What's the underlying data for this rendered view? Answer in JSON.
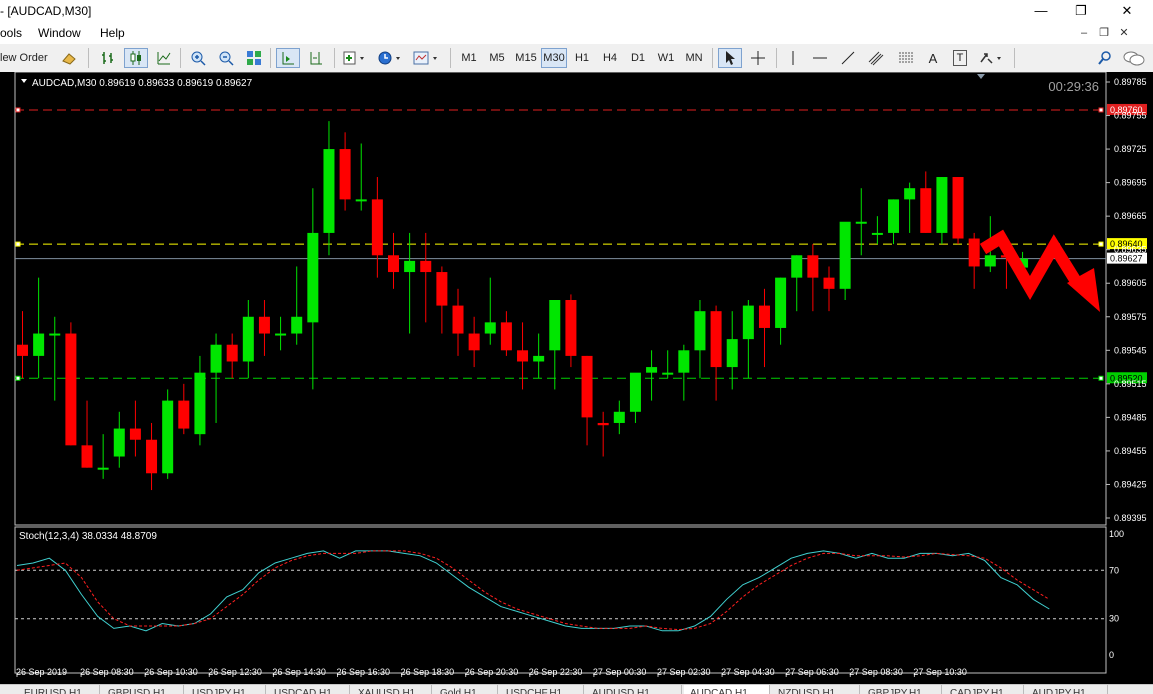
{
  "window": {
    "title": "- [AUDCAD,M30]",
    "minimize_glyph": "—",
    "restore_glyph": "❐",
    "close_glyph": "✕"
  },
  "menu": {
    "items": [
      "ools",
      "Window",
      "Help"
    ],
    "mdi_minimize": "–",
    "mdi_restore": "❐",
    "mdi_close": "✕"
  },
  "toolbar": {
    "new_order_label": "lew Order",
    "timeframes": [
      "M1",
      "M5",
      "M15",
      "M30",
      "H1",
      "H4",
      "D1",
      "W1",
      "MN"
    ],
    "selected_timeframe": "M30",
    "text_tool": "A",
    "label_tool": "T"
  },
  "chart": {
    "header": "AUDCAD,M30  0.89619 0.89633 0.89619 0.89627",
    "timer": "00:29:36",
    "bull_color": "#00e600",
    "bear_color": "#ff0000",
    "price_scale": [
      "0.89785",
      "0.89755",
      "0.89725",
      "0.89695",
      "0.89665",
      "0.89635",
      "0.89605",
      "0.89575",
      "0.89545",
      "0.89515",
      "0.89485",
      "0.89455",
      "0.89425",
      "0.89395"
    ],
    "lines": [
      {
        "name": "resistance",
        "price": 0.8976,
        "label": "0.89760",
        "color": "#e02020"
      },
      {
        "name": "pivot",
        "price": 0.8964,
        "label": "0.89640",
        "color": "#ffff00"
      },
      {
        "name": "support",
        "price": 0.8952,
        "label": "0.89520",
        "color": "#00d000"
      },
      {
        "name": "bid",
        "price": 0.89627,
        "label": "0.89627",
        "color": "#8090a0"
      }
    ],
    "candles": [
      [
        0.8955,
        0.8958,
        0.8952,
        0.8954
      ],
      [
        0.8954,
        0.8961,
        0.8952,
        0.8956
      ],
      [
        0.8956,
        0.89575,
        0.895,
        0.8956
      ],
      [
        0.8956,
        0.8957,
        0.8946,
        0.8946
      ],
      [
        0.8946,
        0.895,
        0.8944,
        0.8944
      ],
      [
        0.8944,
        0.8947,
        0.8943,
        0.8944
      ],
      [
        0.8945,
        0.8949,
        0.8944,
        0.89475
      ],
      [
        0.89475,
        0.895,
        0.8945,
        0.89465
      ],
      [
        0.89465,
        0.8948,
        0.8942,
        0.89435
      ],
      [
        0.89435,
        0.8951,
        0.8943,
        0.895
      ],
      [
        0.895,
        0.89515,
        0.8947,
        0.89475
      ],
      [
        0.8947,
        0.8954,
        0.8946,
        0.89525
      ],
      [
        0.89525,
        0.8956,
        0.8948,
        0.8955
      ],
      [
        0.8955,
        0.8956,
        0.8952,
        0.89535
      ],
      [
        0.89535,
        0.8959,
        0.8952,
        0.89575
      ],
      [
        0.89575,
        0.8959,
        0.8954,
        0.8956
      ],
      [
        0.8956,
        0.89575,
        0.89545,
        0.8956
      ],
      [
        0.8956,
        0.8962,
        0.8955,
        0.89575
      ],
      [
        0.8957,
        0.8969,
        0.8951,
        0.8965
      ],
      [
        0.8965,
        0.8975,
        0.8963,
        0.89725
      ],
      [
        0.89725,
        0.8974,
        0.8967,
        0.8968
      ],
      [
        0.8968,
        0.8973,
        0.8967,
        0.8968
      ],
      [
        0.8968,
        0.897,
        0.8961,
        0.8963
      ],
      [
        0.8963,
        0.8965,
        0.896,
        0.89615
      ],
      [
        0.89615,
        0.8965,
        0.8956,
        0.89625
      ],
      [
        0.89625,
        0.8965,
        0.8957,
        0.89615
      ],
      [
        0.89615,
        0.8962,
        0.8956,
        0.89585
      ],
      [
        0.89585,
        0.896,
        0.8954,
        0.8956
      ],
      [
        0.8956,
        0.89575,
        0.8953,
        0.89545
      ],
      [
        0.8956,
        0.8961,
        0.8955,
        0.8957
      ],
      [
        0.8957,
        0.8958,
        0.8954,
        0.89545
      ],
      [
        0.89545,
        0.8957,
        0.8951,
        0.89535
      ],
      [
        0.89535,
        0.8956,
        0.8952,
        0.8954
      ],
      [
        0.89545,
        0.8959,
        0.8951,
        0.8959
      ],
      [
        0.8959,
        0.89595,
        0.8953,
        0.8954
      ],
      [
        0.8954,
        0.8954,
        0.8946,
        0.89485
      ],
      [
        0.8948,
        0.8949,
        0.8945,
        0.89478
      ],
      [
        0.8948,
        0.895,
        0.8947,
        0.8949
      ],
      [
        0.8949,
        0.8952,
        0.8948,
        0.89525
      ],
      [
        0.89525,
        0.89545,
        0.895,
        0.8953
      ],
      [
        0.89525,
        0.89545,
        0.8952,
        0.89525
      ],
      [
        0.89525,
        0.8955,
        0.895,
        0.89545
      ],
      [
        0.89545,
        0.8959,
        0.8952,
        0.8958
      ],
      [
        0.8958,
        0.89585,
        0.895,
        0.8953
      ],
      [
        0.8953,
        0.8958,
        0.8951,
        0.89555
      ],
      [
        0.89555,
        0.8959,
        0.8952,
        0.89585
      ],
      [
        0.89585,
        0.896,
        0.8953,
        0.89565
      ],
      [
        0.89565,
        0.8961,
        0.8955,
        0.8961
      ],
      [
        0.8961,
        0.8963,
        0.8958,
        0.8963
      ],
      [
        0.8963,
        0.8964,
        0.8958,
        0.8961
      ],
      [
        0.8961,
        0.8962,
        0.8958,
        0.896
      ],
      [
        0.896,
        0.8965,
        0.8959,
        0.8966
      ],
      [
        0.8966,
        0.8969,
        0.8963,
        0.8966
      ],
      [
        0.8965,
        0.89665,
        0.8964,
        0.8965
      ],
      [
        0.8965,
        0.8968,
        0.8964,
        0.8968
      ],
      [
        0.8968,
        0.89695,
        0.8965,
        0.8969
      ],
      [
        0.8969,
        0.89705,
        0.8965,
        0.8965
      ],
      [
        0.8965,
        0.897,
        0.8964,
        0.897
      ],
      [
        0.897,
        0.897,
        0.8964,
        0.89645
      ],
      [
        0.89645,
        0.8965,
        0.896,
        0.8962
      ],
      [
        0.8962,
        0.89665,
        0.89615,
        0.8963
      ],
      [
        0.8963,
        0.8964,
        0.896,
        0.89628
      ],
      [
        0.89619,
        0.89633,
        0.89619,
        0.89627
      ]
    ],
    "stoch_label": "Stoch(12,3,4) 38.0334 48.8709",
    "stoch_scale": [
      "100",
      "70",
      "30",
      "0"
    ],
    "stoch_main": [
      74,
      76,
      80,
      70,
      50,
      32,
      22,
      24,
      20,
      26,
      24,
      26,
      34,
      48,
      54,
      68,
      76,
      80,
      84,
      86,
      80,
      86,
      86,
      86,
      84,
      82,
      76,
      66,
      56,
      48,
      40,
      36,
      32,
      28,
      24,
      22,
      22,
      22,
      24,
      24,
      20,
      20,
      24,
      32,
      46,
      58,
      64,
      72,
      80,
      84,
      86,
      84,
      80,
      84,
      80,
      80,
      84,
      84,
      82,
      84,
      78,
      64,
      58,
      46,
      38
    ],
    "stoch_signal": [
      70,
      72,
      74,
      76,
      64,
      44,
      30,
      24,
      24,
      24,
      24,
      26,
      30,
      40,
      50,
      62,
      72,
      78,
      82,
      84,
      84,
      84,
      86,
      86,
      86,
      84,
      80,
      72,
      62,
      52,
      44,
      38,
      34,
      30,
      26,
      24,
      22,
      22,
      22,
      24,
      22,
      21,
      22,
      26,
      36,
      48,
      58,
      66,
      74,
      80,
      84,
      84,
      82,
      82,
      82,
      81,
      82,
      84,
      83,
      82,
      80,
      72,
      62,
      54,
      46
    ],
    "time_labels": [
      "26 Sep 2019",
      "26 Sep 08:30",
      "26 Sep 10:30",
      "26 Sep 12:30",
      "26 Sep 14:30",
      "26 Sep 16:30",
      "26 Sep 18:30",
      "26 Sep 20:30",
      "26 Sep 22:30",
      "27 Sep 00:30",
      "27 Sep 02:30",
      "27 Sep 04:30",
      "27 Sep 06:30",
      "27 Sep 08:30",
      "27 Sep 10:30"
    ]
  },
  "tabs": [
    "EURUSD,H1",
    "GBPUSD,H1",
    "USDJPY,H1",
    "USDCAD,H1",
    "XAUUSD,H1",
    "Gold,H1",
    "USDCHF,H1",
    "AUDUSD,H1",
    "AUDCAD,H1",
    "NZDUSD,H1",
    "GBPJPY,H1",
    "CADJPY,H1",
    "AUDJPY,H1"
  ]
}
